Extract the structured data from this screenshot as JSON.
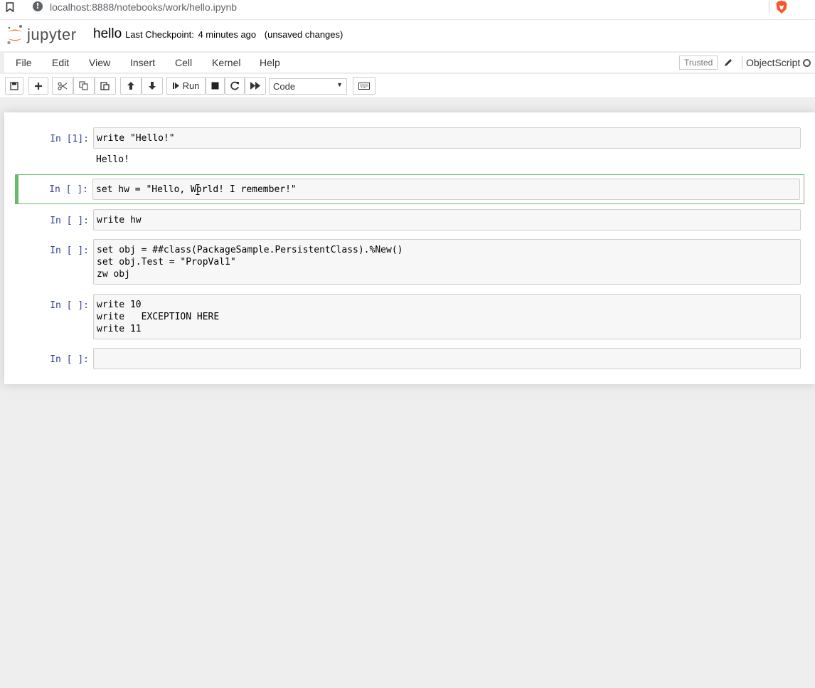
{
  "browser": {
    "url": "localhost:8888/notebooks/work/hello.ipynb"
  },
  "header": {
    "logo_text": "jupyter",
    "notebook_name": "hello",
    "checkpoint_label": "Last Checkpoint:",
    "checkpoint_time": "4 minutes ago",
    "unsaved": "(unsaved changes)"
  },
  "menu": {
    "items": [
      "File",
      "Edit",
      "View",
      "Insert",
      "Cell",
      "Kernel",
      "Help"
    ],
    "trusted": "Trusted",
    "kernel_name": "ObjectScript"
  },
  "toolbar": {
    "run_label": "Run",
    "cell_type": "Code"
  },
  "cells": [
    {
      "prompt": "In [1]:",
      "source": "write \"Hello!\"",
      "output": "Hello!"
    },
    {
      "prompt": "In [ ]:",
      "source": "set hw = \"Hello, World! I remember!\"",
      "selected": true
    },
    {
      "prompt": "In [ ]:",
      "source": "write hw"
    },
    {
      "prompt": "In [ ]:",
      "source": "set obj = ##class(PackageSample.PersistentClass).%New()\nset obj.Test = \"PropVal1\"\nzw obj"
    },
    {
      "prompt": "In [ ]:",
      "source": "write 10\nwrite   EXCEPTION HERE\nwrite 11"
    },
    {
      "prompt": "In [ ]:",
      "source": ""
    }
  ],
  "colors": {
    "jupyter_orange": "#f37726",
    "prompt_blue": "#303f9f",
    "selected_green": "#66bb6a",
    "brave_orange": "#fb542b"
  }
}
